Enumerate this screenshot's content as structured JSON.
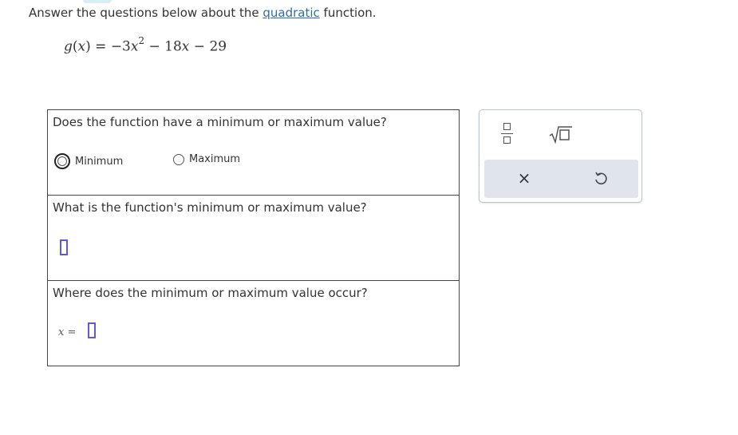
{
  "instructions": {
    "prefix": "Answer the questions below about the ",
    "link": "quadratic",
    "suffix": " function."
  },
  "equation": {
    "lhs_name": "g",
    "lhs_var": "x",
    "coef1": "−3",
    "var1": "x",
    "exp": "2",
    "op2": " − 18",
    "var2": "x",
    "op3": " − 29"
  },
  "questions": {
    "q1": {
      "text": "Does the function have a minimum or maximum value?",
      "options": [
        "Minimum",
        "Maximum"
      ]
    },
    "q2": {
      "text": "What is the function's minimum or maximum value?",
      "value": ""
    },
    "q3": {
      "text": "Where does the minimum or maximum value occur?",
      "var_label": "x",
      "equals": "=",
      "value": ""
    }
  },
  "toolbox": {
    "icons": [
      "fraction-icon",
      "sqrt-icon",
      "clear-icon",
      "undo-icon"
    ],
    "clear_symbol": "×",
    "row_bg": "#dfe5ea"
  },
  "colors": {
    "input_border": "#5b5bdc",
    "link": "#2a6fb0"
  }
}
